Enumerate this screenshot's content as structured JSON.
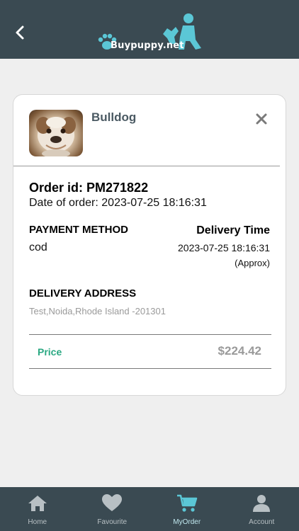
{
  "header": {
    "logo_text": "Buypuppy.net"
  },
  "order": {
    "pet_name": "Bulldog",
    "order_id": "Order id: PM271822",
    "order_date": "Date of order: 2023-07-25 18:16:31",
    "payment_method_heading": "PAYMENT METHOD",
    "payment_method_value": "cod",
    "delivery_time_heading": "Delivery Time",
    "delivery_time_value": "2023-07-25 18:16:31",
    "delivery_time_note": "(Approx)",
    "delivery_address_heading": "DELIVERY ADDRESS",
    "delivery_address_value": "Test,Noida,Rhode Island -201301",
    "price_label": "Price",
    "price_value": "$224.42"
  },
  "nav": {
    "items": [
      {
        "label": "Home",
        "icon": "home-icon"
      },
      {
        "label": "Favourite",
        "icon": "heart-icon"
      },
      {
        "label": "MyOrder",
        "icon": "cart-icon"
      },
      {
        "label": "Account",
        "icon": "user-icon"
      }
    ],
    "active": "MyOrder"
  },
  "colors": {
    "header_bg": "#3a4a52",
    "accent": "#5bc7d6",
    "price_label": "#2aa882",
    "page_bg": "#efefef"
  }
}
